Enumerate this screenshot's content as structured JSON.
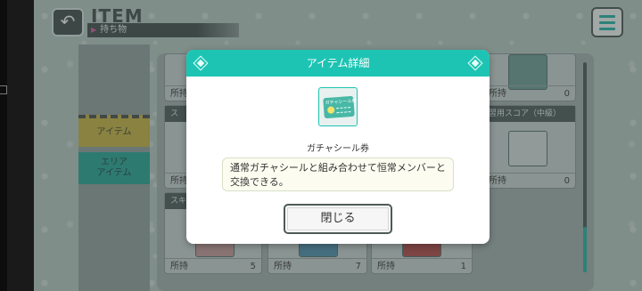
{
  "header": {
    "title": "ITEM",
    "subtitle": "持ち物"
  },
  "categories": [
    {
      "label": "アイテム"
    },
    {
      "label": "エリア\nアイテム"
    }
  ],
  "grid": {
    "own_label": "所持",
    "cards": [
      {
        "count": "",
        "label": ""
      },
      {
        "count": "0",
        "label": ""
      },
      {
        "count": "",
        "label": "ス"
      },
      {
        "count": "0",
        "label": "習用スコア（中級）"
      },
      {
        "count": "",
        "label": "スキル"
      },
      {
        "count": "5",
        "label": ""
      },
      {
        "count": "7",
        "label": ""
      },
      {
        "count": "1",
        "label": ""
      }
    ]
  },
  "modal": {
    "title": "アイテム詳細",
    "icon_text": "ガチャシール券",
    "item_name": "ガチャシール券",
    "description": "通常ガチャシールと組み合わせて恒常メンバーと交換できる。",
    "close_label": "閉じる"
  },
  "colors": {
    "accent": "#1ec4b3",
    "item_tab": "#c8b23e",
    "area_tab": "#21a496"
  }
}
